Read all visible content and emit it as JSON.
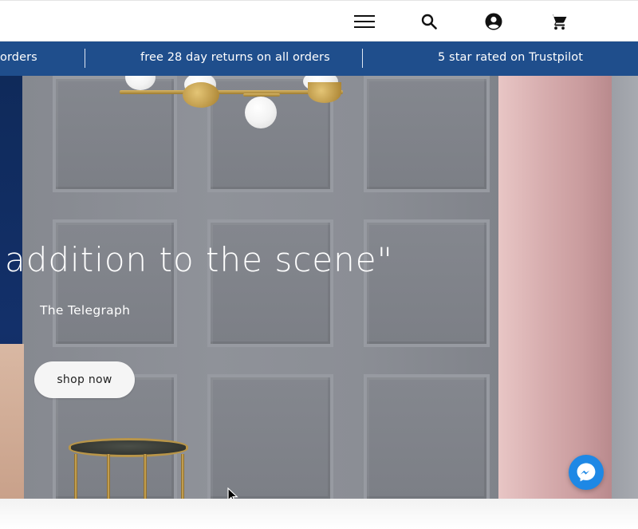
{
  "header": {
    "menu_icon": "hamburger-menu-icon",
    "search_icon": "search-icon",
    "account_icon": "account-icon",
    "cart_icon": "cart-icon"
  },
  "announcements": {
    "items": [
      "orders",
      "free 28 day returns on all orders",
      "5 star rated on Trustpilot"
    ],
    "background": "#1f4e8c",
    "text_color": "#ffffff"
  },
  "hero": {
    "quote": "addition to the scene\"",
    "source": "The Telegraph",
    "cta_label": "shop now"
  },
  "chat": {
    "icon": "messenger-icon",
    "color": "#1e88e5"
  }
}
